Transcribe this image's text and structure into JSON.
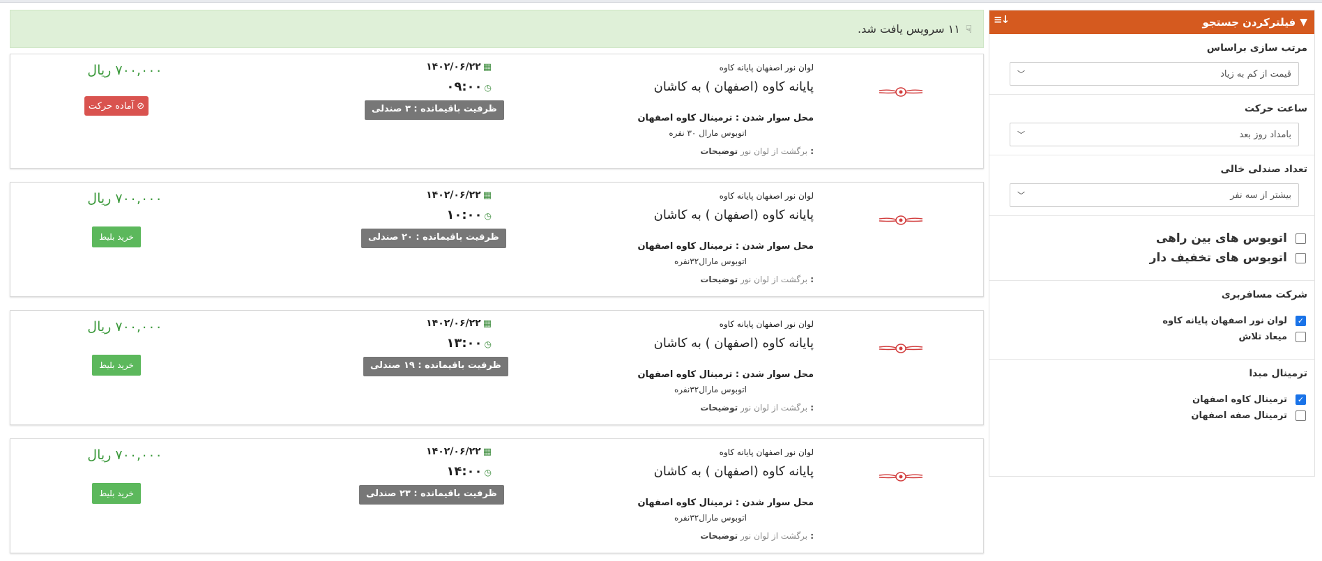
{
  "sidebar": {
    "title": "فیلترکردن جستجو",
    "sort": {
      "label": "مرتب سازی براساس",
      "value": "قیمت از کم به زیاد"
    },
    "departure_time": {
      "label": "ساعت حرکت",
      "value": "بامداد روز بعد"
    },
    "empty_seats": {
      "label": "تعداد صندلی خالی",
      "value": "بیشتر از سه نفر"
    },
    "bus_options": [
      {
        "label": "اتوبوس های بین راهی",
        "checked": false
      },
      {
        "label": "اتوبوس های تخفیف دار",
        "checked": false
      }
    ],
    "companies": {
      "label": "شرکت مسافربری",
      "items": [
        {
          "label": "لوان نور اصفهان پایانه کاوه",
          "checked": true
        },
        {
          "label": "میعاد تلاش",
          "checked": false
        }
      ]
    },
    "origin_terminal": {
      "label": "ترمینال مبدا",
      "items": [
        {
          "label": "ترمینال کاوه اصفهان",
          "checked": true
        },
        {
          "label": "ترمینال صفه اصفهان",
          "checked": false
        }
      ]
    }
  },
  "banner": {
    "text": "۱۱ سرویس یافت شد."
  },
  "services": [
    {
      "company": "لوان نور اصفهان پایانه کاوه",
      "route": "پایانه کاوه (اصفهان ) به کاشان",
      "boarding": "محل سوار شدن : ترمینال کاوه اصفهان",
      "bus_type": "اتوبوس مارال ۳۰ نفره",
      "notes_label": "توضیحات :",
      "notes_text": "برگشت از لوان نور",
      "date": "۱۴۰۲/۰۶/۲۲",
      "time": "۰۹:۰۰",
      "capacity": "ظرفیت باقیمانده : ۳ صندلی",
      "price": "۷۰۰,۰۰۰ ریال",
      "action": "آماده حرکت",
      "action_type": "ready"
    },
    {
      "company": "لوان نور اصفهان پایانه کاوه",
      "route": "پایانه کاوه (اصفهان ) به کاشان",
      "boarding": "محل سوار شدن : ترمینال کاوه اصفهان",
      "bus_type": "اتوبوس مارال۳۲نفره",
      "notes_label": "توضیحات :",
      "notes_text": "برگشت از لوان نور",
      "date": "۱۴۰۲/۰۶/۲۲",
      "time": "۱۰:۰۰",
      "capacity": "ظرفیت باقیمانده : ۲۰ صندلی",
      "price": "۷۰۰,۰۰۰ ریال",
      "action": "خرید بلیط",
      "action_type": "buy"
    },
    {
      "company": "لوان نور اصفهان پایانه کاوه",
      "route": "پایانه کاوه (اصفهان ) به کاشان",
      "boarding": "محل سوار شدن : ترمینال کاوه اصفهان",
      "bus_type": "اتوبوس مارال۳۲نفره",
      "notes_label": "توضیحات :",
      "notes_text": "برگشت از لوان نور",
      "date": "۱۴۰۲/۰۶/۲۲",
      "time": "۱۳:۰۰",
      "capacity": "ظرفیت باقیمانده : ۱۹ صندلی",
      "price": "۷۰۰,۰۰۰ ریال",
      "action": "خرید بلیط",
      "action_type": "buy"
    },
    {
      "company": "لوان نور اصفهان پایانه کاوه",
      "route": "پایانه کاوه (اصفهان ) به کاشان",
      "boarding": "محل سوار شدن : ترمینال کاوه اصفهان",
      "bus_type": "اتوبوس مارال۳۲نفره",
      "notes_label": "توضیحات :",
      "notes_text": "برگشت از لوان نور",
      "date": "۱۴۰۲/۰۶/۲۲",
      "time": "۱۴:۰۰",
      "capacity": "ظرفیت باقیمانده : ۲۳ صندلی",
      "price": "۷۰۰,۰۰۰ ریال",
      "action": "خرید بلیط",
      "action_type": "buy"
    }
  ],
  "colors": {
    "header": "#d55a1f",
    "banner_bg": "#dff0d8",
    "price": "#3d9a3d",
    "buy_button": "#5cb85c",
    "ready_button": "#d9534f",
    "capacity_badge": "#777777",
    "checkbox_on": "#1a73e8"
  },
  "icons": {
    "header": "filter-icon",
    "sort": "sort-icon",
    "banner": "thumbs-down-icon",
    "date": "calendar-icon",
    "time": "clock-icon",
    "ready": "ban-icon",
    "logo": "winged-emblem-logo"
  }
}
